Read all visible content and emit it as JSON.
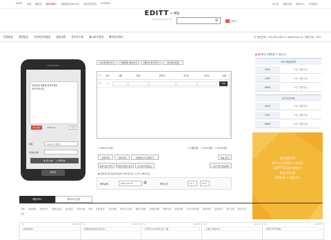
{
  "topnav": {
    "items": [
      "EDITT",
      "쇼핑",
      "블라인",
      "문자서비스",
      "자동응답서비스(A)",
      "자본보안안개",
      "CUPOEN"
    ],
    "active_index": 3,
    "right": [
      "로그인",
      "회원가입",
      "장바구니",
      "고객센터"
    ]
  },
  "logo": {
    "brand": "EDITT",
    "suffix": "• 에딧",
    "tagline": "문자 메시지의 새로운 시작"
  },
  "user": {
    "badge": "5",
    "name": "나의 P..."
  },
  "mainmenu": [
    "친환발송",
    "정한발송",
    "이미지문자발송",
    "발송내역",
    "문자주소록",
    "메시지오관앱",
    "예약문자관리"
  ],
  "mainmenu_right": "CL 충전잔액 : 100,000,000 CL (jethersav.cs) / 충전기공 : 추CL",
  "phone": {
    "message": "전송하실 내용을 입력하세요\n(90이카는지)",
    "badge": "특수문자",
    "counter": "0/90byte",
    "clear": "리셋",
    "sender_label": "제목",
    "sender_value": "help(ok) 자동사",
    "number_label": "보내는사람",
    "number_value": "",
    "option1": "즉시전송",
    "option2": "예약전송",
    "send": "보내기"
  },
  "toolbar": {
    "buttons": [
      "주소록 불러오기",
      "엑셀파일 불러오기",
      "그룹주소록 더보기",
      "최근발신번호"
    ]
  },
  "table": {
    "headers": [
      "NO",
      "그룹",
      "이름",
      "연락처",
      "추가1",
      "추가2",
      "삭제"
    ],
    "row": {
      "no": "1",
      "delete": "삭제"
    }
  },
  "options": {
    "left": "080수신거부",
    "right1": "이름치환",
    "right2": "추가1치환",
    "right3": "추가2치환"
  },
  "actions": {
    "row1": [
      "선택삭제",
      "전체삭제",
      "선택번호 주소록추가"
    ],
    "row2": [
      "중복 번호 제거",
      "엑셀 파일로 받기",
      "주소록 다운로드"
    ],
    "right1": "발송 취지",
    "right2": "수신거부 변호등록"
  },
  "schedule": {
    "note": "예약문자를 발송하실경우 예약일자와 시간을 선택하세요",
    "date_label": "예약날짜",
    "date_value": "2019-04-25",
    "time_label": "예약시간",
    "hour": "21",
    "min": "00"
  },
  "stats": {
    "title": "충전하신 이용현황 이 있습니다.",
    "sec1": "나의 적립금조회",
    "rows1": [
      {
        "k": "SMS",
        "v": "0건 이용가능"
      },
      {
        "k": "LMS",
        "v": "0건 이용가능"
      },
      {
        "k": "MMS",
        "v": "0건 이용가능"
      }
    ],
    "sec2": "나의 코인조회",
    "rows2": [
      {
        "k": "SMS",
        "v": "0건 이용가능"
      },
      {
        "k": "LMS",
        "v": "0건 이용가능"
      },
      {
        "k": "MMS",
        "v": "0건 이용가능"
      }
    ]
  },
  "banner": {
    "line1": "클릭몇번으로",
    "line2": "빠르고 / 저렴하고 / 편리한",
    "line3": "EDITT 업무용 대량문자",
    "line4": "발송서비스를",
    "line5": "이용하실 수 있습니다."
  },
  "tabs": [
    "예문/비스",
    "즐겨쓰는문장"
  ],
  "categories": [
    "전체",
    "사랑/축하",
    "안부/인사",
    "이벤트/공지",
    "홍보/광고",
    "반려/기념",
    "단체",
    "모임/행사/",
    "할인/세일",
    "비지니스/공식",
    "생일/기념일",
    "스페셜/계절",
    "명절/기념",
    "날씨/계절",
    "나의 추천/맞춤",
    "유머/재미",
    "요청/문의",
    "기타 관련",
    "일간/주간/월간"
  ],
  "cards": [
    {
      "tag": "Tut",
      "count": "00 BYTE",
      "body": "안녕하세요?"
    },
    {
      "tag": "Tut",
      "count": "00 BYTE",
      "body": "[세계로에서보내드립니다]"
    },
    {
      "tag": "Tut",
      "count": "00 BYTE",
      "body": "잔사원 A.B(트랜지스터) 사용"
    },
    {
      "tag": "Tut",
      "count": "00 BYTE",
      "body": "고객님 사랑합니다"
    },
    {
      "tag": "Tut",
      "count": "00 BYTE",
      "body": "행복한 하루되세요"
    }
  ],
  "colors": {
    "accent": "#d94a3a",
    "sidebar_bg": "#eef1f5",
    "banner": "#f5b93a",
    "phone": "#2b2b2b"
  }
}
